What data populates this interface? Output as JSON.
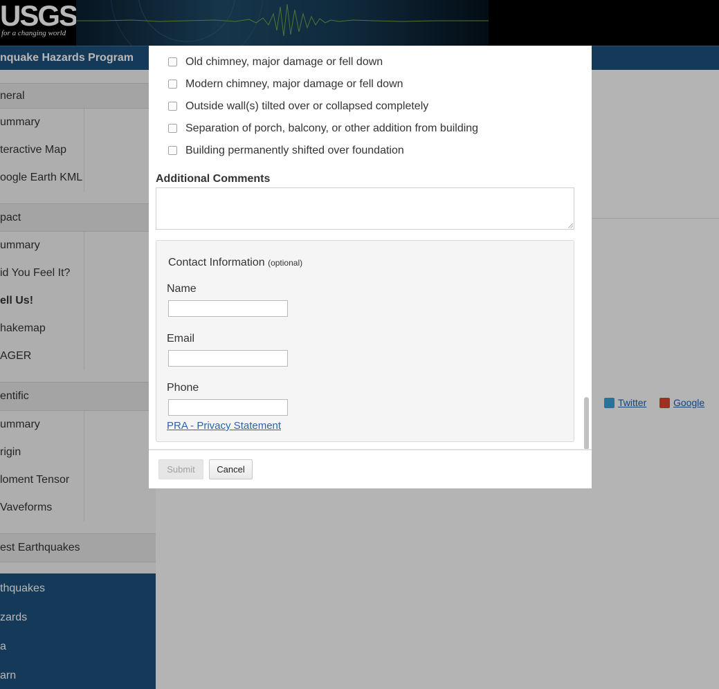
{
  "header": {
    "logo_text": "USGS",
    "logo_tagline": "for a changing world",
    "program_title": "nquake Hazards Program"
  },
  "sidebar": {
    "items": [
      {
        "label": "neral"
      },
      {
        "label": "ummary"
      },
      {
        "label": "teractive Map"
      },
      {
        "label": "oogle Earth KML"
      },
      {
        "label": "pact"
      },
      {
        "label": "ummary"
      },
      {
        "label": "id You Feel It?"
      },
      {
        "label": "ell Us!"
      },
      {
        "label": "hakemap"
      },
      {
        "label": "AGER"
      },
      {
        "label": "entific"
      },
      {
        "label": "ummary"
      },
      {
        "label": "rigin"
      },
      {
        "label": "loment Tensor"
      },
      {
        "label": "Vaveforms"
      },
      {
        "label": "est Earthquakes"
      },
      {
        "label": "thquakes"
      },
      {
        "label": "zards"
      },
      {
        "label": "a"
      },
      {
        "label": "arn"
      }
    ]
  },
  "share": {
    "twitter": "Twitter",
    "google": "Google"
  },
  "modal": {
    "damage_options": [
      {
        "label": "Old chimney, major damage or fell down",
        "checked": false
      },
      {
        "label": "Modern chimney, major damage or fell down",
        "checked": false
      },
      {
        "label": "Outside wall(s) tilted over or collapsed completely",
        "checked": false
      },
      {
        "label": "Separation of porch, balcony, or other addition from building",
        "checked": false
      },
      {
        "label": "Building permanently shifted over foundation",
        "checked": false
      }
    ],
    "comments_label": "Additional Comments",
    "comments_value": "",
    "contact": {
      "legend": "Contact Information",
      "legend_optional": "(optional)",
      "name_label": "Name",
      "name_value": "",
      "email_label": "Email",
      "email_value": "",
      "phone_label": "Phone",
      "phone_value": "",
      "privacy_link": "PRA - Privacy Statement"
    },
    "submit_label": "Submit",
    "cancel_label": "Cancel"
  }
}
